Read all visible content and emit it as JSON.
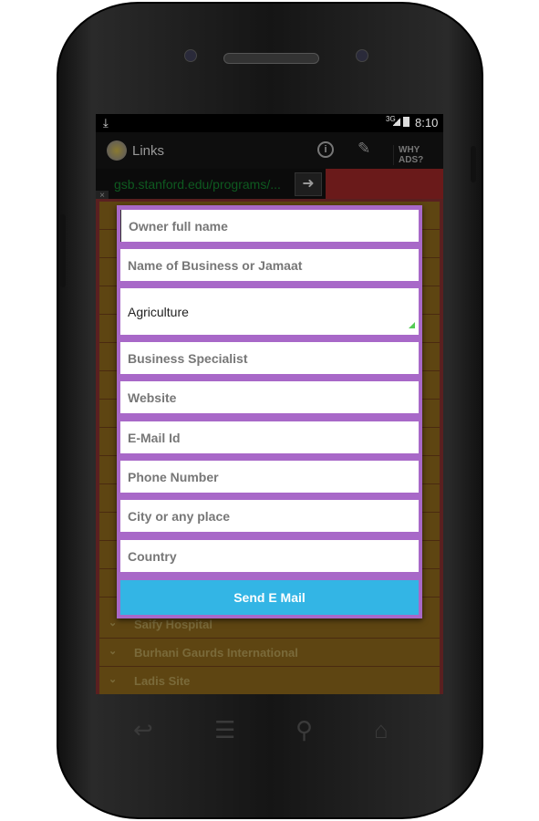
{
  "status": {
    "time": "8:10",
    "network": "3G"
  },
  "actionbar": {
    "title": "Links",
    "why_ads": "WHY ADS?"
  },
  "urlbar": {
    "url": "gsb.stanford.edu/programs/..."
  },
  "list": {
    "items": [
      "Saify Hospital",
      "Burhani Gaurds International",
      "Ladis Site"
    ]
  },
  "dialog": {
    "fields": [
      {
        "placeholder": "Owner full name",
        "value": ""
      },
      {
        "placeholder": "Name of Business or Jamaat",
        "value": ""
      },
      {
        "placeholder": "",
        "value": "Agriculture"
      },
      {
        "placeholder": "Business Specialist",
        "value": ""
      },
      {
        "placeholder": "Website",
        "value": ""
      },
      {
        "placeholder": "E-Mail Id",
        "value": ""
      },
      {
        "placeholder": "Phone Number",
        "value": ""
      },
      {
        "placeholder": "City or any place",
        "value": ""
      },
      {
        "placeholder": "Country",
        "value": ""
      }
    ],
    "send_label": "Send E Mail"
  },
  "colors": {
    "dialog_border": "#a868c8",
    "send_button": "#33b5e5",
    "list_row": "#5e4512"
  }
}
